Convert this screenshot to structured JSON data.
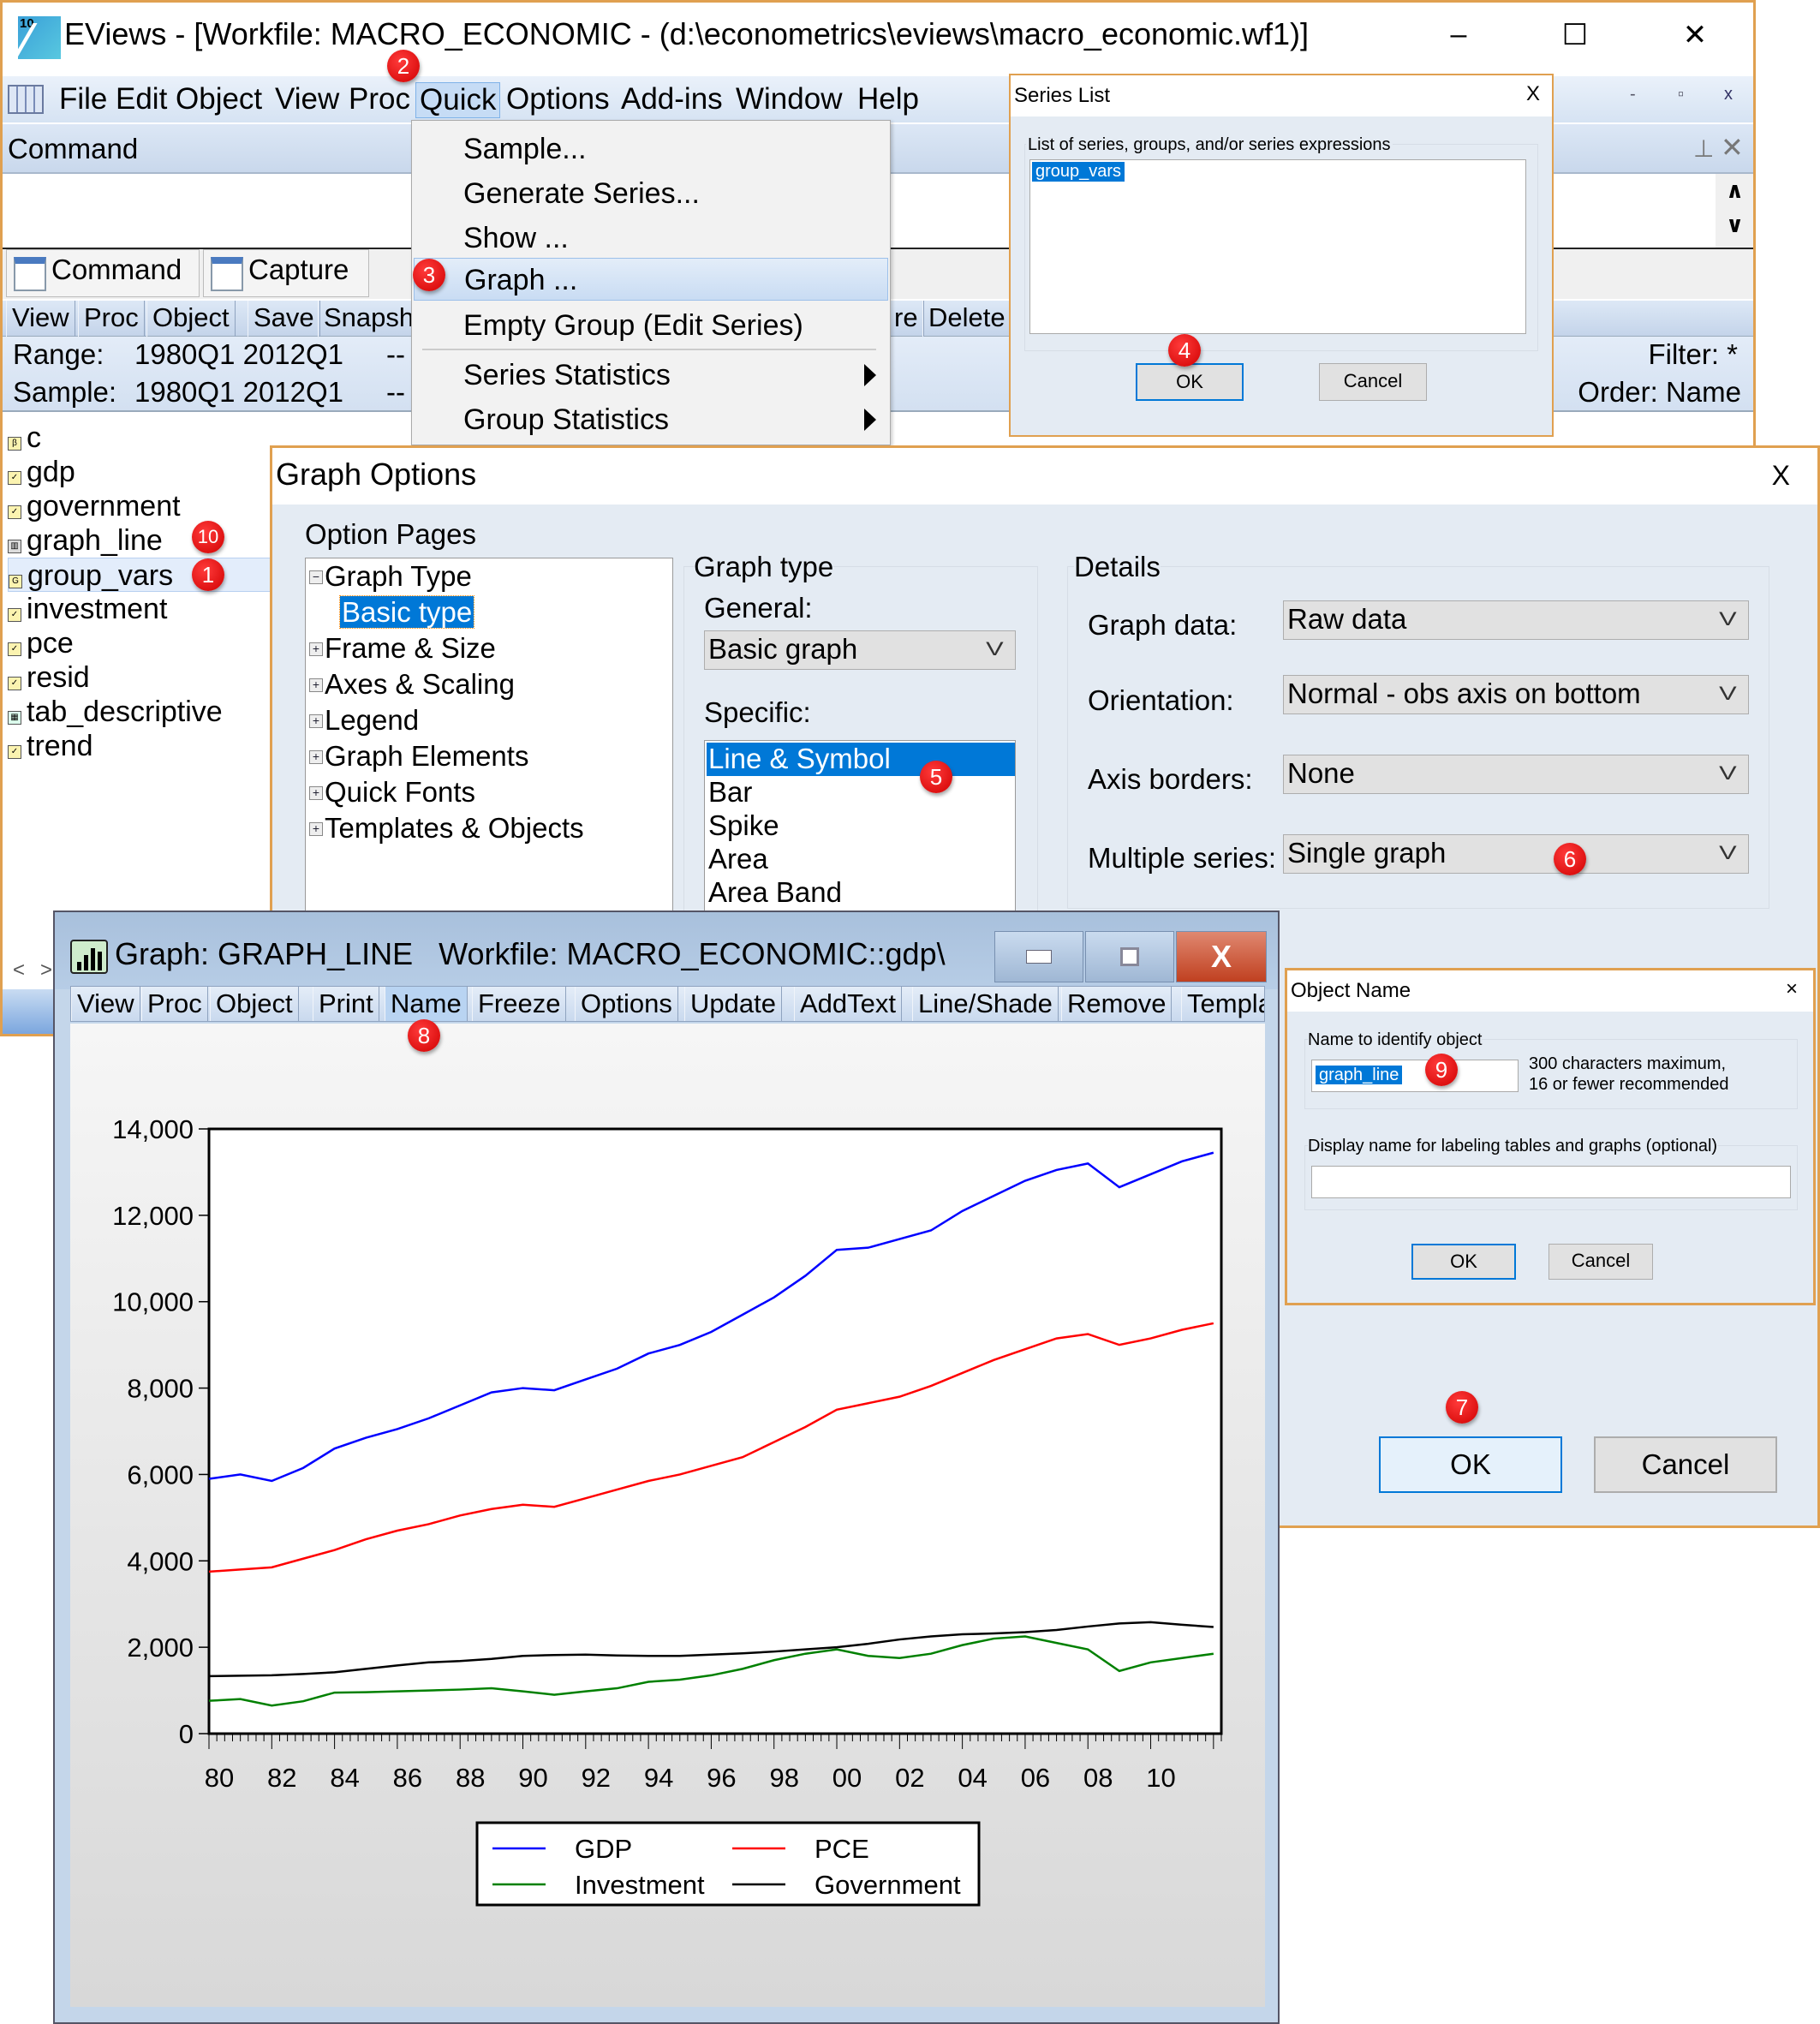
{
  "main_window": {
    "title": "EViews - [Workfile: MACRO_ECONOMIC - (d:\\econometrics\\eviews\\macro_economic.wf1)]",
    "app_icon_version": "10",
    "controls": {
      "minimize": "–",
      "maximize": "☐",
      "close": "✕"
    },
    "menu": [
      "File",
      "Edit",
      "Object",
      "View",
      "Proc",
      "Quick",
      "Options",
      "Add-ins",
      "Window",
      "Help"
    ],
    "active_menu": "Quick",
    "mdi_controls": {
      "minimize": "-",
      "restore": "▫",
      "close": "x"
    },
    "command_pane": {
      "title": "Command",
      "pin": "📌",
      "close": "✕",
      "scroll_up": "∧",
      "scroll_down": "∨",
      "tabs": [
        "Command",
        "Capture"
      ]
    },
    "workfile_toolbar": [
      "View",
      "Proc",
      "Object",
      "Save",
      "Snapsh",
      "re",
      "Delete"
    ],
    "range_label": "Range:",
    "range_value": "1980Q1 2012Q1",
    "range_suffix": "--",
    "sample_label": "Sample:",
    "sample_value": "1980Q1 2012Q1",
    "sample_suffix": "--",
    "filter": "Filter: *",
    "order": "Order: Name",
    "objects": [
      {
        "name": "c",
        "icon": "coef-icon",
        "glyph": "β"
      },
      {
        "name": "gdp",
        "icon": "series-icon",
        "glyph": "✓"
      },
      {
        "name": "government",
        "icon": "series-icon",
        "glyph": "✓"
      },
      {
        "name": "graph_line",
        "icon": "graph-icon",
        "glyph": "▥"
      },
      {
        "name": "group_vars",
        "icon": "group-icon",
        "glyph": "G",
        "selected": true
      },
      {
        "name": "investment",
        "icon": "series-icon",
        "glyph": "✓"
      },
      {
        "name": "pce",
        "icon": "series-icon",
        "glyph": "✓"
      },
      {
        "name": "resid",
        "icon": "series-icon",
        "glyph": "✓"
      },
      {
        "name": "tab_descriptive",
        "icon": "table-icon",
        "glyph": "▦"
      },
      {
        "name": "trend",
        "icon": "series-icon",
        "glyph": "✓"
      }
    ],
    "nav": {
      "left": "<",
      "right": ">"
    }
  },
  "quick_menu": {
    "items": [
      {
        "label": "Sample...",
        "submenu": false
      },
      {
        "label": "Generate Series...",
        "submenu": false
      },
      {
        "label": "Show ...",
        "submenu": false
      },
      {
        "label": "Graph ...",
        "submenu": false,
        "highlighted": true
      },
      {
        "label": "Empty Group (Edit Series)",
        "submenu": false
      },
      {
        "label": "Series Statistics",
        "submenu": true
      },
      {
        "label": "Group Statistics",
        "submenu": true
      }
    ]
  },
  "series_list_dialog": {
    "title": "Series List",
    "close": "X",
    "group_label": "List of series, groups, and/or series expressions",
    "value": "group_vars",
    "ok": "OK",
    "cancel": "Cancel"
  },
  "graph_options_dialog": {
    "title": "Graph Options",
    "close": "X",
    "option_pages_label": "Option Pages",
    "tree": [
      {
        "label": "Graph Type",
        "expander": "−",
        "level": 0
      },
      {
        "label": "Basic type",
        "expander": "",
        "level": 1,
        "selected": true
      },
      {
        "label": "Frame & Size",
        "expander": "+",
        "level": 0
      },
      {
        "label": "Axes & Scaling",
        "expander": "+",
        "level": 0
      },
      {
        "label": "Legend",
        "expander": "+",
        "level": 0
      },
      {
        "label": "Graph Elements",
        "expander": "+",
        "level": 0
      },
      {
        "label": "Quick Fonts",
        "expander": "+",
        "level": 0
      },
      {
        "label": "Templates & Objects",
        "expander": "+",
        "level": 0
      }
    ],
    "graph_type_label": "Graph type",
    "general_label": "General:",
    "general_value": "Basic graph",
    "specific_label": "Specific:",
    "specific_items": [
      "Line & Symbol",
      "Bar",
      "Spike",
      "Area",
      "Area Band"
    ],
    "specific_selected": "Line & Symbol",
    "details_label": "Details",
    "details": [
      {
        "label": "Graph data:",
        "value": "Raw data"
      },
      {
        "label": "Orientation:",
        "value": "Normal - obs axis on bottom"
      },
      {
        "label": "Axis borders:",
        "value": "None"
      },
      {
        "label": "Multiple series:",
        "value": "Single graph"
      }
    ],
    "chevron": "V",
    "ok": "OK",
    "cancel": "Cancel"
  },
  "graph_window": {
    "title": "Graph: GRAPH_LINE   Workfile: MACRO_ECONOMIC::gdp\\",
    "toolbar": [
      "View",
      "Proc",
      "Object",
      "Print",
      "Name",
      "Freeze",
      "Options",
      "Update",
      "AddText",
      "Line/Shade",
      "Remove",
      "Templa"
    ],
    "active_tool": "Name",
    "controls": {
      "minimize": "▬",
      "restore": "▣",
      "close": "X"
    }
  },
  "object_name_dialog": {
    "title": "Object Name",
    "close": "×",
    "name_label": "Name to identify object",
    "name_value": "graph_line",
    "hint_line1": "300 characters maximum,",
    "hint_line2": "16 or fewer recommended",
    "display_label": "Display name for labeling tables and graphs  (optional)",
    "display_value": "",
    "ok": "OK",
    "cancel": "Cancel"
  },
  "callouts": [
    "1",
    "2",
    "3",
    "4",
    "5",
    "6",
    "7",
    "8",
    "9",
    "10"
  ],
  "colors": {
    "window_border": "#e0a050",
    "selection": "#0078d7",
    "badge": "#e00000",
    "gdp": "#0000ff",
    "pce": "#ff0000",
    "investment": "#008000",
    "government": "#000000"
  },
  "chart_data": {
    "type": "line",
    "title": "",
    "xlabel": "",
    "ylabel": "",
    "x": [
      1980,
      1981,
      1982,
      1983,
      1984,
      1985,
      1986,
      1987,
      1988,
      1989,
      1990,
      1991,
      1992,
      1993,
      1994,
      1995,
      1996,
      1997,
      1998,
      1999,
      2000,
      2001,
      2002,
      2003,
      2004,
      2005,
      2006,
      2007,
      2008,
      2009,
      2010,
      2011,
      2012
    ],
    "x_range": [
      1980,
      2012.25
    ],
    "x_tick_labels": [
      "80",
      "82",
      "84",
      "86",
      "88",
      "90",
      "92",
      "94",
      "96",
      "98",
      "00",
      "02",
      "04",
      "06",
      "08",
      "10"
    ],
    "x_tick_years": [
      1980,
      1982,
      1984,
      1986,
      1988,
      1990,
      1992,
      1994,
      1996,
      1998,
      2000,
      2002,
      2004,
      2006,
      2008,
      2010
    ],
    "ylim": [
      0,
      14000
    ],
    "y_ticks": [
      0,
      2000,
      4000,
      6000,
      8000,
      10000,
      12000,
      14000
    ],
    "y_tick_labels": [
      "0",
      "2,000",
      "4,000",
      "6,000",
      "8,000",
      "10,000",
      "12,000",
      "14,000"
    ],
    "grid": false,
    "legend_position": "bottom-center",
    "series": [
      {
        "name": "GDP",
        "color": "#0000ff",
        "values": [
          5900,
          6000,
          5850,
          6150,
          6600,
          6850,
          7050,
          7300,
          7600,
          7900,
          8000,
          7950,
          8200,
          8450,
          8800,
          9000,
          9300,
          9700,
          10100,
          10600,
          11200,
          11250,
          11450,
          11650,
          12100,
          12450,
          12800,
          13050,
          13200,
          12650,
          12950,
          13250,
          13450
        ]
      },
      {
        "name": "PCE",
        "color": "#ff0000",
        "values": [
          3750,
          3800,
          3850,
          4050,
          4250,
          4500,
          4700,
          4850,
          5050,
          5200,
          5300,
          5250,
          5450,
          5650,
          5850,
          6000,
          6200,
          6400,
          6750,
          7100,
          7500,
          7650,
          7800,
          8050,
          8350,
          8650,
          8900,
          9150,
          9250,
          9000,
          9150,
          9350,
          9500
        ]
      },
      {
        "name": "Investment",
        "color": "#008000",
        "values": [
          760,
          800,
          650,
          750,
          950,
          960,
          980,
          1000,
          1020,
          1050,
          980,
          900,
          980,
          1050,
          1200,
          1250,
          1350,
          1500,
          1700,
          1850,
          1950,
          1800,
          1750,
          1850,
          2050,
          2200,
          2250,
          2100,
          1950,
          1450,
          1650,
          1750,
          1850
        ]
      },
      {
        "name": "Government",
        "color": "#000000",
        "values": [
          1330,
          1340,
          1350,
          1380,
          1420,
          1500,
          1580,
          1650,
          1680,
          1730,
          1800,
          1820,
          1830,
          1810,
          1800,
          1800,
          1830,
          1860,
          1900,
          1950,
          2000,
          2080,
          2180,
          2250,
          2300,
          2320,
          2350,
          2400,
          2480,
          2550,
          2580,
          2520,
          2470
        ]
      }
    ]
  }
}
